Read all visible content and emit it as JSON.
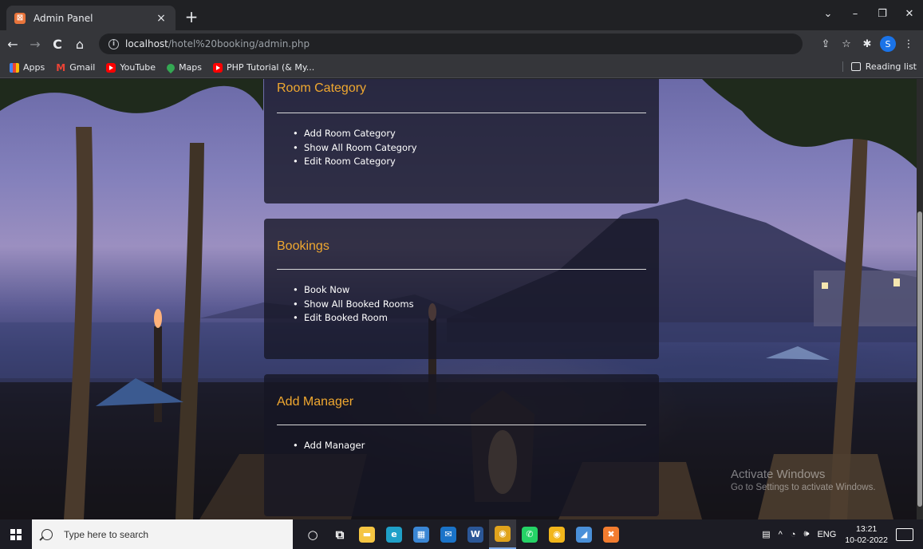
{
  "browser": {
    "tab": {
      "favicon": "xampp-icon",
      "title": "Admin Panel",
      "close": "×"
    },
    "new_tab": "+",
    "window_controls": {
      "minimize": "–",
      "maximize": "❐",
      "close": "✕",
      "tab_search": "⌄"
    },
    "nav": {
      "back": "←",
      "forward": "→",
      "reload": "C",
      "home": "⌂"
    },
    "address": {
      "host": "localhost",
      "path": "/hotel%20booking/admin.php",
      "info": "i"
    },
    "toolbar": {
      "share": "⇪",
      "star": "☆",
      "extensions": "✱",
      "profile": "S",
      "menu": "⋮"
    },
    "bookmarks": [
      {
        "label": "Apps",
        "icon": "apps-icon"
      },
      {
        "label": "Gmail",
        "icon": "gmail-icon"
      },
      {
        "label": "YouTube",
        "icon": "youtube-icon"
      },
      {
        "label": "Maps",
        "icon": "maps-icon"
      },
      {
        "label": "PHP Tutorial (& My...",
        "icon": "youtube-icon"
      }
    ],
    "reading_list": "Reading list"
  },
  "page": {
    "panels": [
      {
        "title": "Room Category",
        "items": [
          "Add Room Category",
          "Show All Room Category",
          "Edit Room Category"
        ]
      },
      {
        "title": "Bookings",
        "items": [
          "Book Now",
          "Show All Booked Rooms",
          "Edit Booked Room"
        ]
      },
      {
        "title": "Add Manager",
        "items": [
          "Add Manager"
        ]
      }
    ],
    "watermark": {
      "line1": "Activate Windows",
      "line2": "Go to Settings to activate Windows."
    }
  },
  "taskbar": {
    "search_placeholder": "Type here to search",
    "apps": [
      {
        "name": "cortana-icon",
        "glyph": "○",
        "color": "transparent"
      },
      {
        "name": "task-view-icon",
        "glyph": "⧉",
        "color": "transparent"
      },
      {
        "name": "file-explorer-icon",
        "glyph": "▬",
        "color": "#f5c542"
      },
      {
        "name": "edge-icon",
        "glyph": "e",
        "color": "#1fa0c8"
      },
      {
        "name": "store-icon",
        "glyph": "▦",
        "color": "#3a86d4"
      },
      {
        "name": "mail-icon",
        "glyph": "✉",
        "color": "#1a73c8"
      },
      {
        "name": "word-icon",
        "glyph": "W",
        "color": "#2b5797"
      },
      {
        "name": "chrome-icon",
        "glyph": "◉",
        "color": "#e0a31c"
      },
      {
        "name": "whatsapp-icon",
        "glyph": "✆",
        "color": "#25d366"
      },
      {
        "name": "chrome-canary-icon",
        "glyph": "◉",
        "color": "#f2b61b"
      },
      {
        "name": "app-icon",
        "glyph": "◢",
        "color": "#4a90d9"
      },
      {
        "name": "xampp-icon",
        "glyph": "✖",
        "color": "#f27c2f"
      }
    ],
    "tray": {
      "language": "ENG",
      "time": "13:21",
      "date": "10-02-2022"
    }
  }
}
